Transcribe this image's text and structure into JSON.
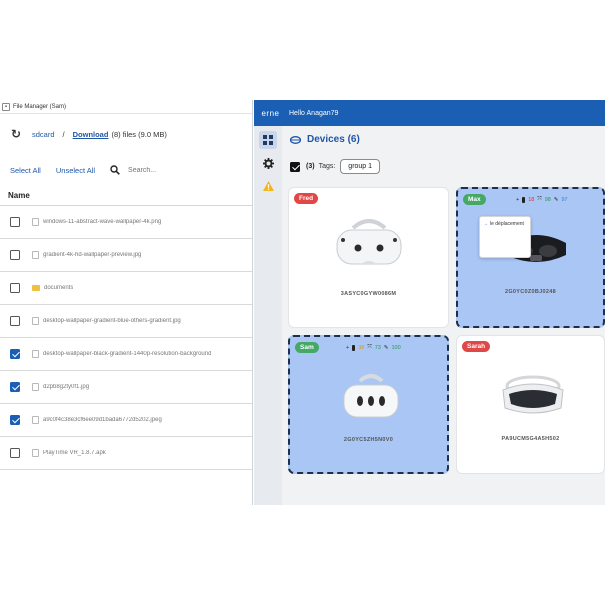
{
  "file_manager": {
    "title": "File Manager (Sam)",
    "path": {
      "root": "sdcard",
      "separator": "/",
      "current": "Download",
      "count": "(8) files (9.0 MB)"
    },
    "actions": {
      "select_all": "Select All",
      "unselect_all": "Unselect All",
      "search_placeholder": "Search..."
    },
    "column_header": "Name",
    "files": [
      {
        "name": "windows-11-abstract-wave-wallpaper-4k.png",
        "checked": false,
        "type": "file"
      },
      {
        "name": "gradient-4k-hd-wallpaper-preview.jpg",
        "checked": false,
        "type": "file"
      },
      {
        "name": "documents",
        "checked": false,
        "type": "folder"
      },
      {
        "name": "desktop-wallpaper-gradient-blue-others-gradient.jpg",
        "checked": false,
        "type": "file"
      },
      {
        "name": "desktop-wallpaper-black-gradient-1440p-resolution-background",
        "checked": true,
        "type": "file"
      },
      {
        "name": "d2pb8g2ty0f1.jpg",
        "checked": true,
        "type": "file"
      },
      {
        "name": "a9c0f4c38e3cf6ee09d1bada6772d5202.jpeg",
        "checked": true,
        "type": "file"
      },
      {
        "name": "PlayTime VR_1.8.7.apk",
        "checked": false,
        "type": "file"
      }
    ]
  },
  "device_manager": {
    "logo": "erne",
    "greeting": "Hello Anagan79",
    "rail": [
      {
        "icon": "dashboard-icon",
        "active": true
      },
      {
        "icon": "gear-icon",
        "active": false
      },
      {
        "icon": "warning-icon",
        "active": false
      }
    ],
    "title": "Devices (6)",
    "filter": {
      "selected_count": "(3)",
      "tags_label": "Tags:",
      "tag": "group 1"
    },
    "tooltip": "le déplacement",
    "devices": [
      {
        "name": "Fred",
        "badge_color": "#e04848",
        "serial": "3ASYC0GYW0086M",
        "selected": false,
        "headset": "quest2",
        "stats": null
      },
      {
        "name": "Max",
        "badge_color": "#44a866",
        "serial": "2G0YC0Z0BJ0248",
        "selected": true,
        "headset": "quest-pro",
        "stats": {
          "s1": "+",
          "battery": "18",
          "wifi": "98",
          "storage": "97"
        }
      },
      {
        "name": "Sam",
        "badge_color": "#44a866",
        "serial": "2G0YC5ZH5N0V0",
        "selected": true,
        "headset": "quest3",
        "stats": {
          "s1": "+",
          "battery": "38",
          "wifi": "73",
          "storage": "100"
        }
      },
      {
        "name": "Sarah",
        "badge_color": "#e04848",
        "serial": "PA9UCM5G4A5H502",
        "selected": false,
        "headset": "pico",
        "stats": null
      }
    ]
  },
  "colors": {
    "accent": "#1a5fb4",
    "selected_card": "#a9c6f5"
  }
}
